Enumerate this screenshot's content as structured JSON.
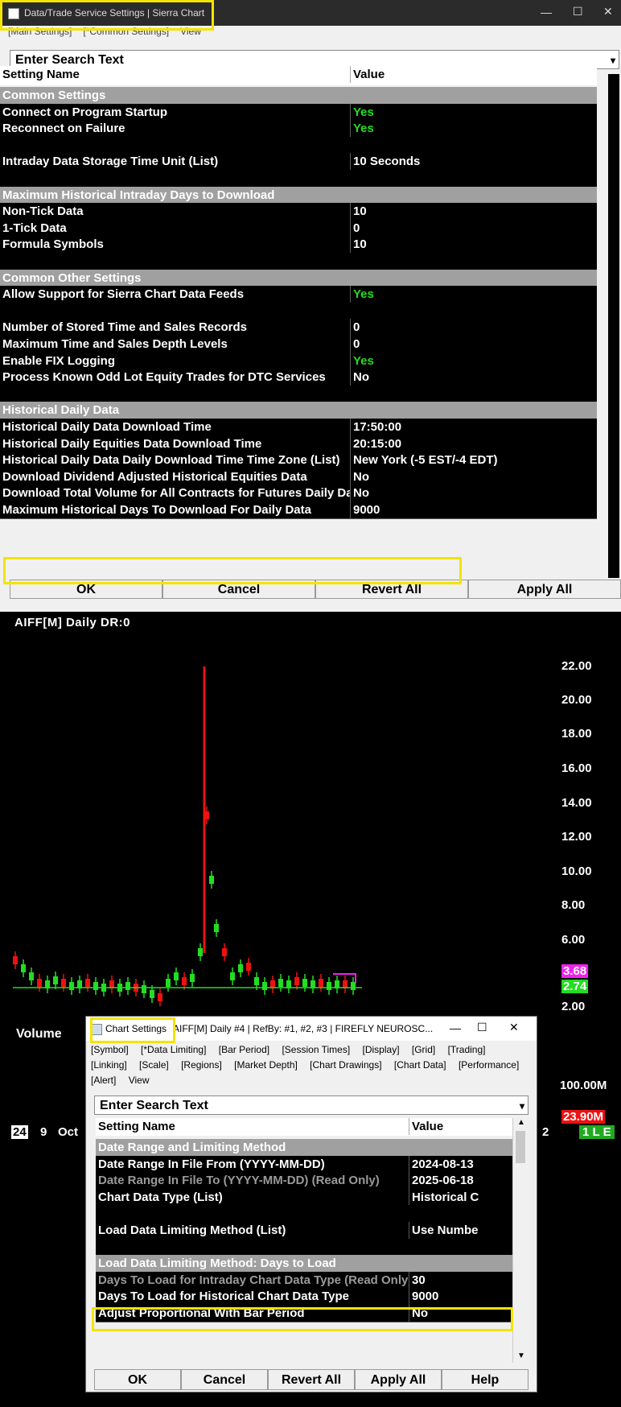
{
  "win1": {
    "title": "Data/Trade Service Settings | Sierra Chart",
    "menu": [
      "[Main Settings]",
      "[*Common Settings]",
      "View"
    ],
    "search_placeholder": "Enter Search Text",
    "headers": {
      "name": "Setting Name",
      "value": "Value"
    },
    "rows": [
      {
        "type": "section",
        "name": "Common Settings"
      },
      {
        "type": "setting",
        "name": "Connect on Program Startup",
        "value": "Yes"
      },
      {
        "type": "setting",
        "name": "Reconnect on Failure",
        "value": "Yes"
      },
      {
        "type": "blank"
      },
      {
        "type": "setting",
        "name": "Intraday Data Storage Time Unit (List)",
        "value": "10 Seconds"
      },
      {
        "type": "blank"
      },
      {
        "type": "section",
        "name": "Maximum Historical Intraday Days to Download"
      },
      {
        "type": "setting",
        "name": "Non-Tick Data",
        "value": "10"
      },
      {
        "type": "setting",
        "name": "1-Tick Data",
        "value": "0"
      },
      {
        "type": "setting",
        "name": "Formula Symbols",
        "value": "10"
      },
      {
        "type": "blank"
      },
      {
        "type": "section",
        "name": "Common Other Settings"
      },
      {
        "type": "setting",
        "name": "Allow Support for Sierra Chart Data Feeds",
        "value": "Yes"
      },
      {
        "type": "blank"
      },
      {
        "type": "setting",
        "name": "Number of Stored Time and Sales Records",
        "value": "0"
      },
      {
        "type": "setting",
        "name": "Maximum Time and Sales Depth Levels",
        "value": "0"
      },
      {
        "type": "setting",
        "name": "Enable FIX Logging",
        "value": "Yes"
      },
      {
        "type": "setting",
        "name": "Process Known Odd Lot Equity Trades for DTC Services",
        "value": "No"
      },
      {
        "type": "blank"
      },
      {
        "type": "section",
        "name": "Historical Daily Data"
      },
      {
        "type": "setting",
        "name": "Historical Daily Data Download Time",
        "value": "17:50:00"
      },
      {
        "type": "setting",
        "name": "Historical Daily Equities Data Download Time",
        "value": "20:15:00"
      },
      {
        "type": "setting",
        "name": "Historical Daily Data Daily Download Time Time Zone (List)",
        "value": "New York (-5 EST/-4 EDT)"
      },
      {
        "type": "setting",
        "name": "Download Dividend Adjusted Historical Equities Data",
        "value": "No"
      },
      {
        "type": "setting",
        "name": "Download Total Volume for All Contracts for Futures Daily Data",
        "value": "No"
      },
      {
        "type": "setting",
        "name": "Maximum Historical Days To Download For Daily Data",
        "value": "9000"
      }
    ],
    "buttons": [
      "OK",
      "Cancel",
      "Revert All",
      "Apply All"
    ]
  },
  "chart": {
    "title": "AIFF[M] Daily DR:0",
    "price_labels": [
      "22.00",
      "20.00",
      "18.00",
      "16.00",
      "14.00",
      "12.00",
      "10.00",
      "8.00",
      "6.00",
      "2.00"
    ],
    "badge_magenta": "3.68",
    "badge_green": "2.74",
    "volume_label": "Volume",
    "volume_axis": "100.00M",
    "volume_badge": "23.90M",
    "x_labels": [
      "24",
      "9",
      "Oct"
    ],
    "x_right": "2",
    "status_badge": "1 L E",
    "colors": {
      "up": "#22dd22",
      "down": "#ee1111",
      "magenta": "#ee22ee"
    }
  },
  "win2": {
    "title": "Chart Settings",
    "title_rest": "AIFF[M]  Daily #4 | RefBy: #1, #2, #3 | FIREFLY NEUROSC...",
    "tabs": [
      "[Symbol]",
      "[*Data Limiting]",
      "[Bar Period]",
      "[Session Times]",
      "[Display]",
      "[Grid]",
      "[Trading]",
      "[Linking]",
      "[Scale]",
      "[Regions]",
      "[Market Depth]",
      "[Chart Drawings]",
      "[Chart Data]",
      "[Performance]",
      "[Alert]",
      "View"
    ],
    "search_placeholder": "Enter Search Text",
    "headers": {
      "name": "Setting Name",
      "value": "Value"
    },
    "rows": [
      {
        "type": "section",
        "name": "Date Range and Limiting Method"
      },
      {
        "type": "setting",
        "name": "Date Range In File From (YYYY-MM-DD)",
        "value": "2024-08-13"
      },
      {
        "type": "readonly",
        "name": "Date Range In File To (YYYY-MM-DD) (Read Only)",
        "value": "2025-06-18"
      },
      {
        "type": "setting",
        "name": "Chart Data Type (List)",
        "value": "Historical C"
      },
      {
        "type": "blank"
      },
      {
        "type": "setting",
        "name": "Load Data Limiting Method (List)",
        "value": "Use Numbe"
      },
      {
        "type": "blank"
      },
      {
        "type": "section",
        "name": "Load Data Limiting Method: Days to Load"
      },
      {
        "type": "readonly",
        "name": "Days To Load for Intraday Chart Data Type (Read Only)",
        "value": "30"
      },
      {
        "type": "setting",
        "name": "Days To Load for Historical Chart Data Type",
        "value": "9000"
      },
      {
        "type": "setting",
        "name": "Adjust Proportional With Bar Period",
        "value": "No"
      }
    ],
    "buttons": [
      "OK",
      "Cancel",
      "Revert All",
      "Apply All",
      "Help"
    ]
  }
}
